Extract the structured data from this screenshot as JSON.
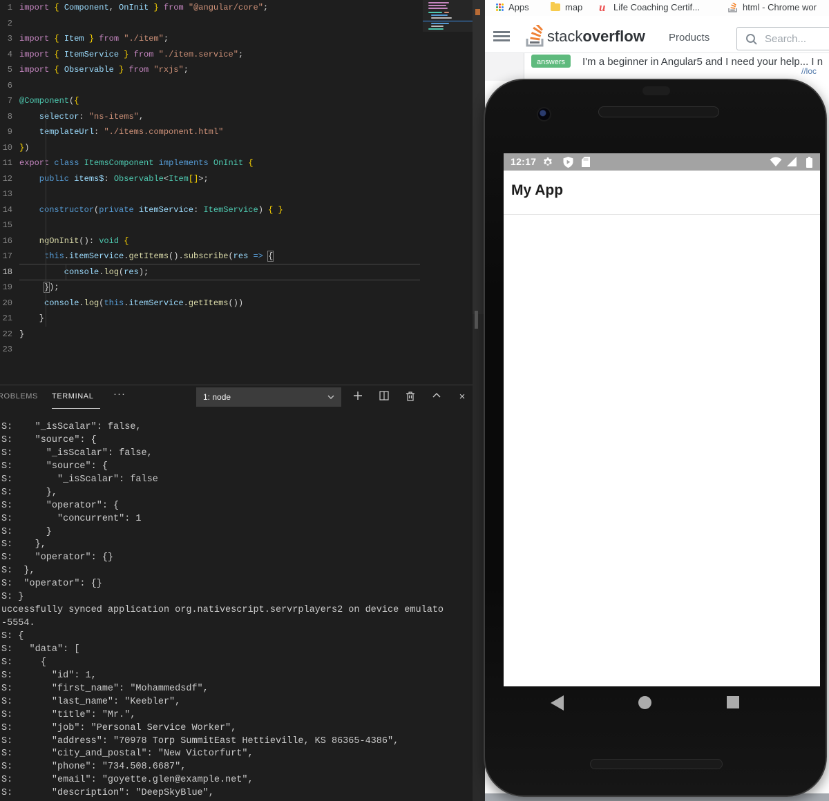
{
  "vscode": {
    "code_lines": [
      {
        "n": 1,
        "s": [
          [
            "k",
            "import "
          ],
          [
            "g",
            "{ "
          ],
          [
            "v",
            "Component"
          ],
          [
            "p",
            ", "
          ],
          [
            "v",
            "OnInit"
          ],
          [
            "g",
            " }"
          ],
          [
            "k",
            " from "
          ],
          [
            "s",
            "\"@angular/core\""
          ],
          [
            "p",
            ";"
          ]
        ]
      },
      {
        "n": 2,
        "s": []
      },
      {
        "n": 3,
        "s": [
          [
            "k",
            "import "
          ],
          [
            "g",
            "{ "
          ],
          [
            "v",
            "Item"
          ],
          [
            "g",
            " }"
          ],
          [
            "k",
            " from "
          ],
          [
            "s",
            "\"./item\""
          ],
          [
            "p",
            ";"
          ]
        ]
      },
      {
        "n": 4,
        "s": [
          [
            "k",
            "import "
          ],
          [
            "g",
            "{ "
          ],
          [
            "v",
            "ItemService"
          ],
          [
            "g",
            " }"
          ],
          [
            "k",
            " from "
          ],
          [
            "s",
            "\"./item.service\""
          ],
          [
            "p",
            ";"
          ]
        ]
      },
      {
        "n": 5,
        "s": [
          [
            "k",
            "import "
          ],
          [
            "g",
            "{ "
          ],
          [
            "v",
            "Observable"
          ],
          [
            "g",
            " }"
          ],
          [
            "k",
            " from "
          ],
          [
            "s",
            "\"rxjs\""
          ],
          [
            "p",
            ";"
          ]
        ]
      },
      {
        "n": 6,
        "s": []
      },
      {
        "n": 7,
        "s": [
          [
            "t",
            "@Component"
          ],
          [
            "p",
            "("
          ],
          [
            "g",
            "{"
          ]
        ]
      },
      {
        "n": 8,
        "s": [
          [
            "v",
            "    selector"
          ],
          [
            "p",
            ": "
          ],
          [
            "s",
            "\"ns-items\""
          ],
          [
            "p",
            ","
          ]
        ]
      },
      {
        "n": 9,
        "s": [
          [
            "v",
            "    templateUrl"
          ],
          [
            "p",
            ": "
          ],
          [
            "s",
            "\"./items.component.html\""
          ]
        ]
      },
      {
        "n": 10,
        "s": [
          [
            "g",
            "}"
          ],
          [
            "p",
            ")"
          ]
        ]
      },
      {
        "n": 11,
        "s": [
          [
            "k",
            "export "
          ],
          [
            "b",
            "class "
          ],
          [
            "t",
            "ItemsComponent "
          ],
          [
            "b",
            "implements "
          ],
          [
            "t",
            "OnInit "
          ],
          [
            "g",
            "{"
          ]
        ]
      },
      {
        "n": 12,
        "s": [
          [
            "b",
            "    public "
          ],
          [
            "v",
            "items$"
          ],
          [
            "p",
            ": "
          ],
          [
            "t",
            "Observable"
          ],
          [
            "p",
            "<"
          ],
          [
            "t",
            "Item"
          ],
          [
            "g",
            "[]"
          ],
          [
            "p",
            ">;"
          ]
        ]
      },
      {
        "n": 13,
        "s": []
      },
      {
        "n": 14,
        "s": [
          [
            "b",
            "    constructor"
          ],
          [
            "p",
            "("
          ],
          [
            "b",
            "private "
          ],
          [
            "v",
            "itemService"
          ],
          [
            "p",
            ": "
          ],
          [
            "t",
            "ItemService"
          ],
          [
            "p",
            ") "
          ],
          [
            "g",
            "{ }"
          ]
        ]
      },
      {
        "n": 15,
        "s": []
      },
      {
        "n": 16,
        "s": [
          [
            "y",
            "    ngOnInit"
          ],
          [
            "p",
            "(): "
          ],
          [
            "t",
            "void "
          ],
          [
            "g",
            "{"
          ]
        ]
      },
      {
        "n": 17,
        "s": [
          [
            "b",
            "     this"
          ],
          [
            "p",
            "."
          ],
          [
            "v",
            "itemService"
          ],
          [
            "p",
            "."
          ],
          [
            "y",
            "getItems"
          ],
          [
            "p",
            "()."
          ],
          [
            "y",
            "subscribe"
          ],
          [
            "p",
            "("
          ],
          [
            "v",
            "res "
          ],
          [
            "b",
            "=> "
          ],
          [
            "x",
            "{"
          ]
        ]
      },
      {
        "n": 18,
        "s": [
          [
            "v",
            "         console"
          ],
          [
            "p",
            "."
          ],
          [
            "y",
            "log"
          ],
          [
            "p",
            "("
          ],
          [
            "v",
            "res"
          ],
          [
            "p",
            ");"
          ]
        ]
      },
      {
        "n": 19,
        "s": [
          [
            "p",
            "     "
          ],
          [
            "x",
            "}"
          ],
          [
            "p",
            ");"
          ]
        ]
      },
      {
        "n": 20,
        "s": [
          [
            "v",
            "     console"
          ],
          [
            "p",
            "."
          ],
          [
            "y",
            "log"
          ],
          [
            "p",
            "("
          ],
          [
            "b",
            "this"
          ],
          [
            "p",
            "."
          ],
          [
            "v",
            "itemService"
          ],
          [
            "p",
            "."
          ],
          [
            "y",
            "getItems"
          ],
          [
            "p",
            "())"
          ]
        ]
      },
      {
        "n": 21,
        "s": [
          [
            "p",
            "    }"
          ]
        ]
      },
      {
        "n": 22,
        "s": [
          [
            "p",
            "}"
          ]
        ]
      },
      {
        "n": 23,
        "s": []
      }
    ],
    "panel": {
      "problems_tab": "ROBLEMS",
      "terminal_tab": "TERMINAL",
      "more_label": "···",
      "terminal_select": "1: node"
    },
    "terminal_lines": [
      "S:    \"_isScalar\": false,",
      "S:    \"source\": {",
      "S:      \"_isScalar\": false,",
      "S:      \"source\": {",
      "S:        \"_isScalar\": false",
      "S:      },",
      "S:      \"operator\": {",
      "S:        \"concurrent\": 1",
      "S:      }",
      "S:    },",
      "S:    \"operator\": {}",
      "S:  },",
      "S:  \"operator\": {}",
      "S: }",
      "uccessfully synced application org.nativescript.servrplayers2 on device emulato",
      "-5554.",
      "S: {",
      "S:   \"data\": [",
      "S:     {",
      "S:       \"id\": 1,",
      "S:       \"first_name\": \"Mohammedsdf\",",
      "S:       \"last_name\": \"Keebler\",",
      "S:       \"title\": \"Mr.\",",
      "S:       \"job\": \"Personal Service Worker\",",
      "S:       \"address\": \"70978 Torp SummitEast Hettieville, KS 86365-4386\",",
      "S:       \"city_and_postal\": \"New Victorfurt\",",
      "S:       \"phone\": \"734.508.6687\",",
      "S:       \"email\": \"goyette.glen@example.net\",",
      "S:       \"description\": \"DeepSkyBlue\","
    ]
  },
  "browser": {
    "bookmarks_bar": {
      "apps_label": "Apps",
      "map_label": "map",
      "udemy_glyph": "u",
      "udemy_label": "Life Coaching Certif...",
      "so_label": "html - Chrome wor"
    },
    "header": {
      "brand_stack": "stack",
      "brand_overflow": "overflow",
      "products_label": "Products",
      "search_placeholder": "Search..."
    },
    "question": {
      "answers_badge": "answers",
      "title": "I'm a beginner in Angular5 and I need your help... I n",
      "partial_link": "//loc"
    }
  },
  "phone": {
    "status_time": "12:17",
    "app_title": "My App"
  },
  "colors": {
    "so_orange": "#ee8227",
    "answer_green": "#5eba7d",
    "vscode_bg": "#1e1e1e",
    "statusbar_gray": "#a3a3a3",
    "bracket_gold": "#ffd700",
    "minimap_line_blue": "#3b8eea",
    "google_dot_colors": [
      "#4285f4",
      "#ea4335",
      "#fbbc05",
      "#34a853",
      "#ea4335",
      "#4285f4",
      "#fbbc05",
      "#34a853",
      "#4285f4"
    ]
  },
  "icons": [
    "apps-grid-icon",
    "folder-icon",
    "udemy-icon",
    "stackoverflow-favicon",
    "menu-icon",
    "stackoverflow-logo-icon",
    "search-icon",
    "add-terminal-icon",
    "split-terminal-icon",
    "kill-terminal-icon",
    "maximize-panel-icon",
    "close-panel-icon",
    "dropdown-chevron-icon",
    "gear-icon",
    "play-protect-shield-icon",
    "sd-card-icon",
    "wifi-icon",
    "cellular-icon",
    "battery-icon",
    "nav-back-icon",
    "nav-home-icon",
    "nav-recents-icon",
    "camera-icon"
  ]
}
